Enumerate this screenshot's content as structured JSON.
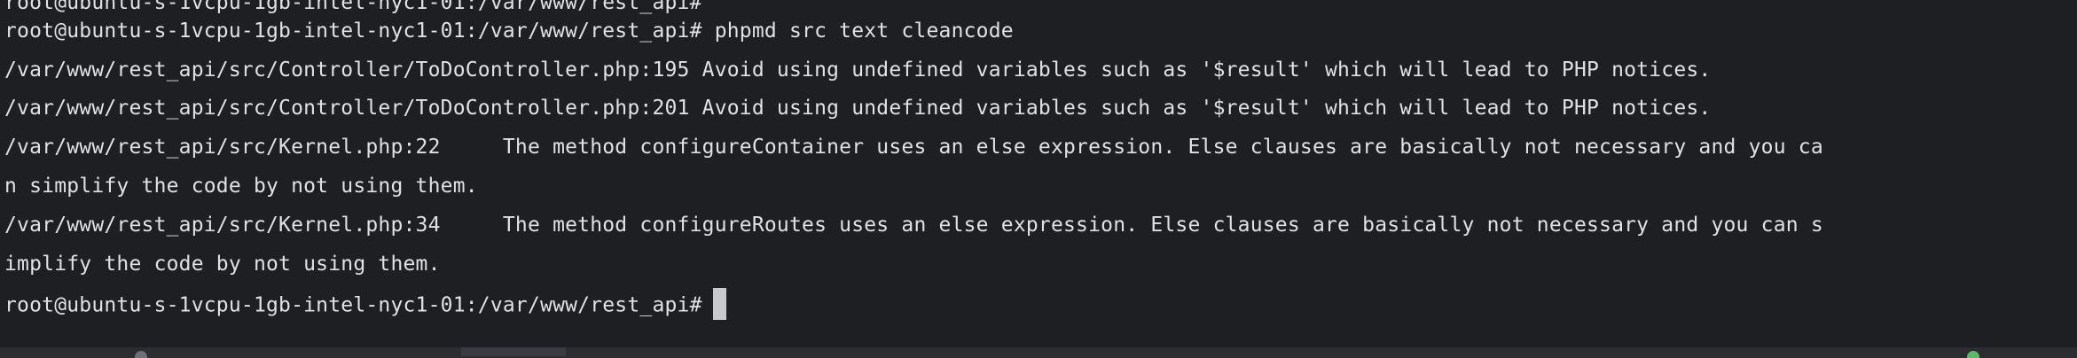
{
  "terminal": {
    "prev_line": "root@ubuntu-s-1vcpu-1gb-intel-nyc1-01:/var/www/rest_api#",
    "lines": [
      "root@ubuntu-s-1vcpu-1gb-intel-nyc1-01:/var/www/rest_api# phpmd src text cleancode",
      "/var/www/rest_api/src/Controller/ToDoController.php:195 Avoid using undefined variables such as '$result' which will lead to PHP notices.",
      "/var/www/rest_api/src/Controller/ToDoController.php:201 Avoid using undefined variables such as '$result' which will lead to PHP notices.",
      "/var/www/rest_api/src/Kernel.php:22     The method configureContainer uses an else expression. Else clauses are basically not necessary and you ca",
      "n simplify the code by not using them.",
      "/var/www/rest_api/src/Kernel.php:34     The method configureRoutes uses an else expression. Else clauses are basically not necessary and you can s",
      "implify the code by not using them."
    ],
    "prompt": "root@ubuntu-s-1vcpu-1gb-intel-nyc1-01:/var/www/rest_api#"
  }
}
